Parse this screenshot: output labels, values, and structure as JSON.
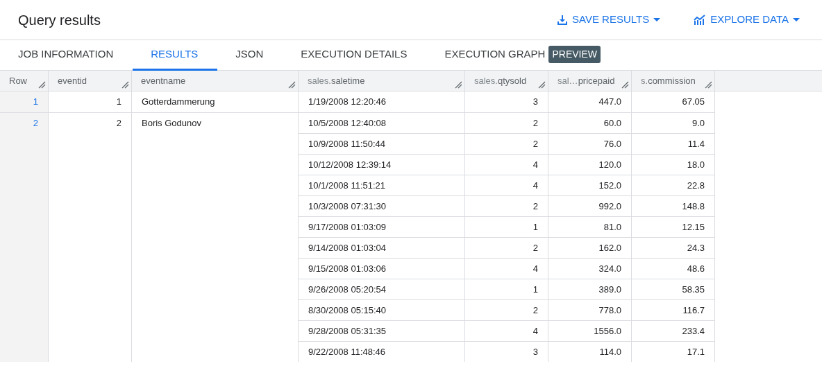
{
  "title": "Query results",
  "actions": [
    {
      "label": "SAVE RESULTS",
      "kind": "download"
    },
    {
      "label": "EXPLORE DATA",
      "kind": "chart"
    }
  ],
  "tabs": [
    {
      "label": "JOB INFORMATION",
      "selected": false
    },
    {
      "label": "RESULTS",
      "selected": true
    },
    {
      "label": "JSON",
      "selected": false
    },
    {
      "label": "EXECUTION DETAILS",
      "selected": false
    },
    {
      "label": "EXECUTION GRAPH",
      "selected": false,
      "badge": "PREVIEW"
    }
  ],
  "table": {
    "columns": [
      {
        "name": "Row"
      },
      {
        "name": "eventid"
      },
      {
        "name": "eventname"
      },
      {
        "prefix": "sales.",
        "name": "saletime"
      },
      {
        "prefix": "sales.",
        "name": "qtysold"
      },
      {
        "prefix": "sal…",
        "name": "pricepaid"
      },
      {
        "prefix": "s.",
        "name": "commission"
      }
    ],
    "rows": [
      {
        "row": "1",
        "eventid": "1",
        "eventname": "Gotterdammerung",
        "sales": [
          [
            "1/19/2008 12:20:46",
            "3",
            "447.0",
            "67.05"
          ]
        ]
      },
      {
        "row": "2",
        "eventid": "2",
        "eventname": "Boris Godunov",
        "sales": [
          [
            "10/5/2008 12:40:08",
            "2",
            "60.0",
            "9.0"
          ],
          [
            "10/9/2008 11:50:44",
            "2",
            "76.0",
            "11.4"
          ],
          [
            "10/12/2008 12:39:14",
            "4",
            "120.0",
            "18.0"
          ],
          [
            "10/1/2008 11:51:21",
            "4",
            "152.0",
            "22.8"
          ],
          [
            "10/3/2008 07:31:30",
            "2",
            "992.0",
            "148.8"
          ],
          [
            "9/17/2008 01:03:09",
            "1",
            "81.0",
            "12.15"
          ],
          [
            "9/14/2008 01:03:04",
            "2",
            "162.0",
            "24.3"
          ],
          [
            "9/15/2008 01:03:06",
            "4",
            "324.0",
            "48.6"
          ],
          [
            "9/26/2008 05:20:54",
            "1",
            "389.0",
            "58.35"
          ],
          [
            "8/30/2008 05:15:40",
            "2",
            "778.0",
            "116.7"
          ],
          [
            "9/28/2008 05:31:35",
            "4",
            "1556.0",
            "233.4"
          ],
          [
            "9/22/2008 11:48:46",
            "3",
            "114.0",
            "17.1"
          ]
        ]
      }
    ]
  }
}
